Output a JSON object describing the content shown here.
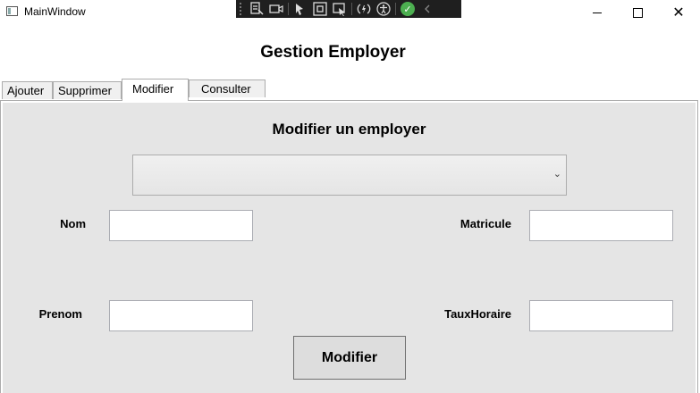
{
  "window": {
    "title": "MainWindow",
    "controls": {
      "minimize": "minimize-icon",
      "maximize": "maximize-icon",
      "close": "close-icon"
    }
  },
  "devbar": {
    "tools": [
      "select-visual-tree-icon",
      "record-icon",
      "select-element-icon",
      "display-layout-adorners-icon",
      "track-focused-element-icon",
      "hot-reload-icon",
      "accessibility-icon",
      "binding-failures-ok-icon",
      "collapse-icon"
    ]
  },
  "header": {
    "title": "Gestion Employer"
  },
  "tabs": [
    {
      "label": "Ajouter",
      "selected": false
    },
    {
      "label": "Supprimer",
      "selected": false
    },
    {
      "label": "Modifier",
      "selected": true
    },
    {
      "label": "Consulter",
      "selected": false
    }
  ],
  "form": {
    "title": "Modifier un employer",
    "employee_select": {
      "value": ""
    },
    "nom": {
      "label": "Nom",
      "value": ""
    },
    "prenom": {
      "label": "Prenom",
      "value": ""
    },
    "matricule": {
      "label": "Matricule",
      "value": ""
    },
    "taux_horaire": {
      "label": "TauxHoraire",
      "value": ""
    },
    "submit_label": "Modifier"
  },
  "colors": {
    "panel_background": "#e5e5e5",
    "tab_border": "#acacac",
    "devbar_background": "#1f1f1f",
    "check_green": "#4caf50"
  }
}
